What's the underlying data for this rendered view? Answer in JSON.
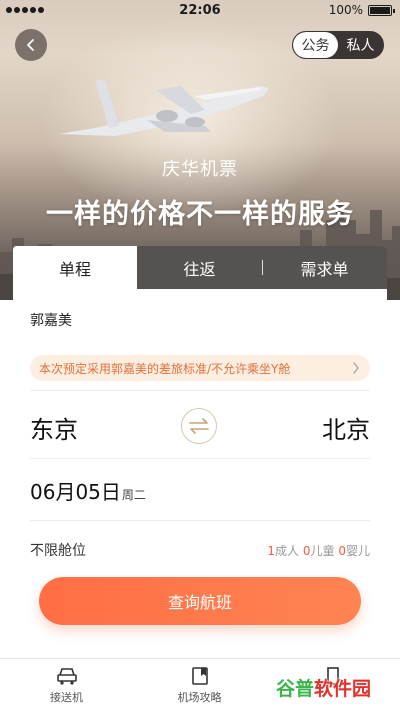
{
  "status_bar": {
    "time": "22:06",
    "battery": "100%"
  },
  "header": {
    "toggle_options": [
      "公务",
      "私人"
    ],
    "toggle_selected": "公务",
    "subtitle": "庆华机票",
    "slogan": "一样的价格不一样的服务"
  },
  "tabs": [
    {
      "label": "单程",
      "active": true
    },
    {
      "label": "往返",
      "active": false
    },
    {
      "label": "需求单",
      "active": false
    }
  ],
  "form": {
    "passenger": "郭嘉美",
    "notice": "本次预定采用郭嘉美的差旅标准/不允许乘坐Y舱",
    "from_city": "东京",
    "to_city": "北京",
    "date": "06月05日",
    "weekday": "周二",
    "cabin_label": "不限舱位",
    "adult_count": "1",
    "adult_label": "成人",
    "child_count": "0",
    "child_label": "儿童",
    "infant_count": "0",
    "infant_label": "婴儿",
    "search_button": "查询航班"
  },
  "bottom_nav": [
    {
      "label": "接送机",
      "icon": "car-icon"
    },
    {
      "label": "机场攻略",
      "icon": "book-icon"
    },
    {
      "label": "",
      "icon": "hotel-icon"
    }
  ],
  "watermark": {
    "part1": "谷普",
    "part2": "软件园"
  },
  "colors": {
    "accent": "#ff6e45",
    "notice_text": "#e2703b",
    "notice_bg": "#fcefe2",
    "watermark_green": "#3bb54a",
    "watermark_red": "#e3312d"
  }
}
